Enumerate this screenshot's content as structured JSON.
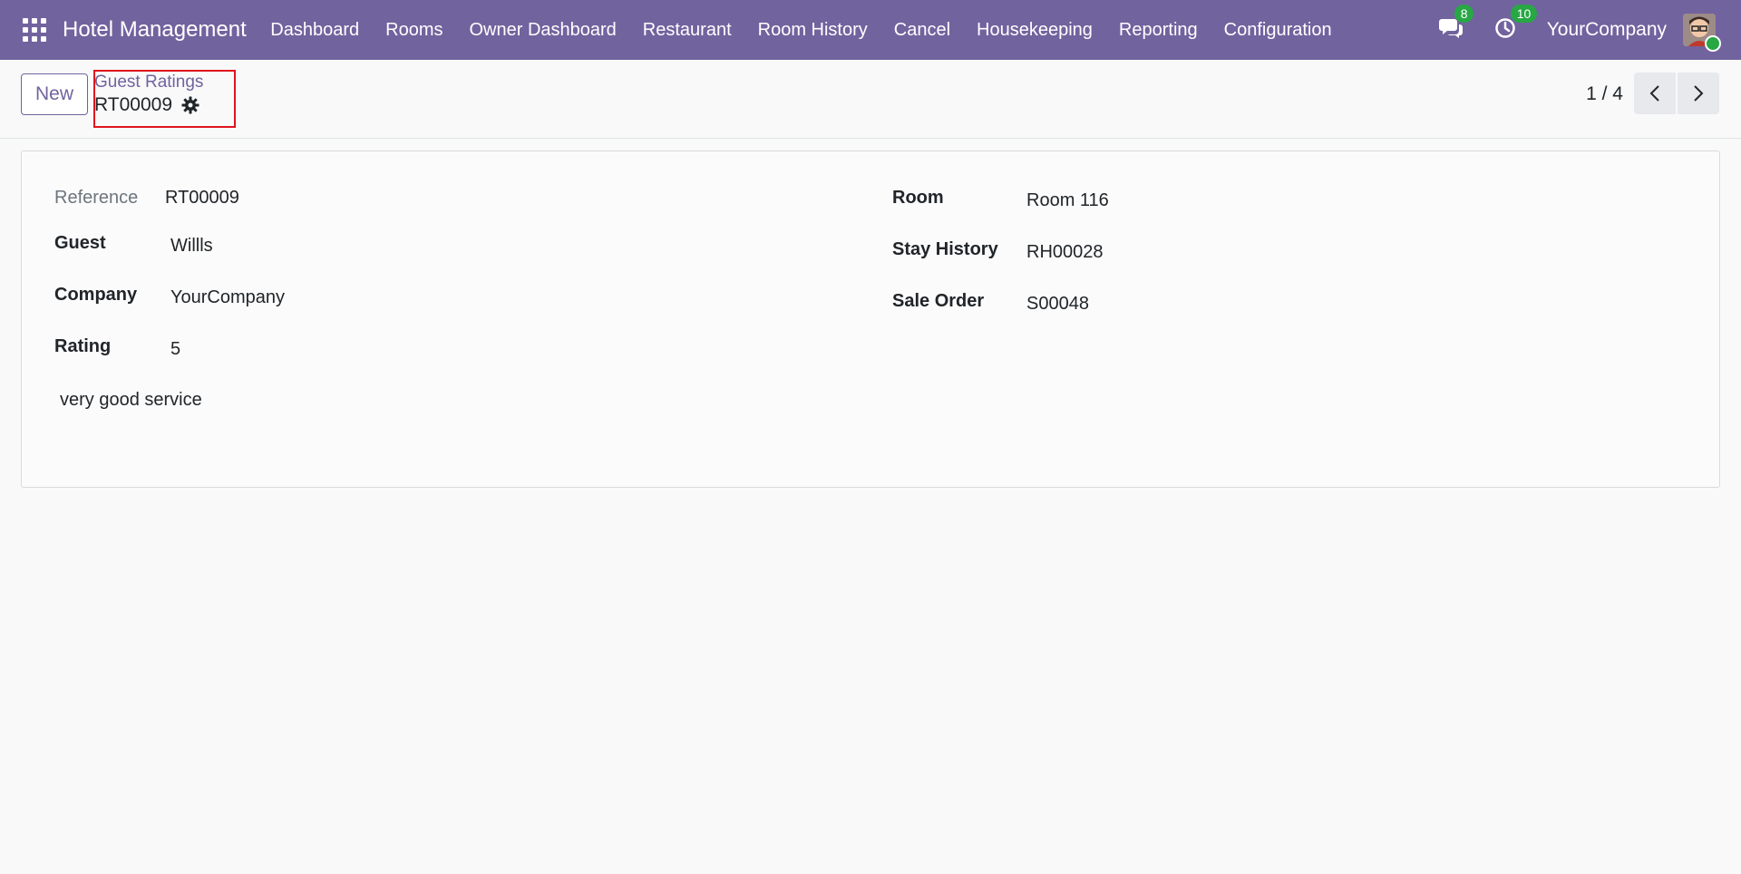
{
  "navbar": {
    "brand": "Hotel Management",
    "menu": [
      "Dashboard",
      "Rooms",
      "Owner Dashboard",
      "Restaurant",
      "Room History",
      "Cancel",
      "Housekeeping",
      "Reporting",
      "Configuration"
    ],
    "messages_count": "8",
    "activities_count": "10",
    "company": "YourCompany",
    "colors": {
      "bar": "#71639e",
      "badge": "#28a745"
    }
  },
  "control_panel": {
    "new_label": "New",
    "breadcrumb_parent": "Guest Ratings",
    "breadcrumb_current": "RT00009",
    "pager": "1 / 4"
  },
  "form": {
    "reference": {
      "label": "Reference",
      "value": "RT00009"
    },
    "guest": {
      "label": "Guest",
      "value": "Willls"
    },
    "company": {
      "label": "Company",
      "value": "YourCompany"
    },
    "rating": {
      "label": "Rating",
      "value": "5"
    },
    "comment": "very good service",
    "room": {
      "label": "Room",
      "value": "Room 116"
    },
    "stay_history": {
      "label": "Stay History",
      "value": "RH00028"
    },
    "sale_order": {
      "label": "Sale Order",
      "value": "S00048"
    }
  }
}
